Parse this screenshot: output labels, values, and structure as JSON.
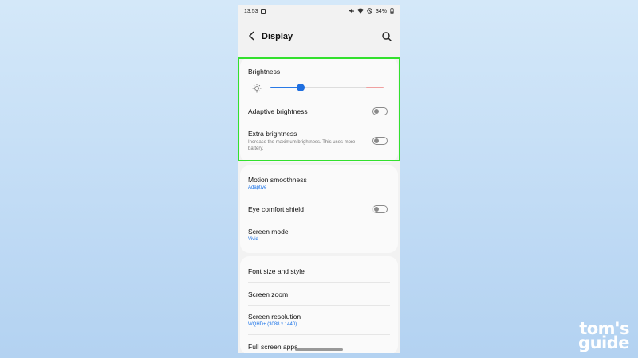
{
  "status_bar": {
    "time": "13:53",
    "battery": "34%",
    "icons": [
      "gallery-icon",
      "mute-icon",
      "wifi-icon",
      "do-not-disturb-icon",
      "battery-icon"
    ]
  },
  "app_bar": {
    "title": "Display",
    "back_icon": "back-arrow-icon",
    "search_icon": "search-icon"
  },
  "brightness_card": {
    "brightness_label": "Brightness",
    "brightness_level": 0.27,
    "adaptive_brightness": {
      "label": "Adaptive brightness",
      "enabled": false
    },
    "extra_brightness": {
      "label": "Extra brightness",
      "description": "Increase the maximum brightness. This uses more battery.",
      "enabled": false
    }
  },
  "display_card": {
    "motion_smoothness": {
      "label": "Motion smoothness",
      "value": "Adaptive"
    },
    "eye_comfort": {
      "label": "Eye comfort shield",
      "enabled": false
    },
    "screen_mode": {
      "label": "Screen mode",
      "value": "Vivid"
    }
  },
  "more_card": {
    "font_size": {
      "label": "Font size and style"
    },
    "screen_zoom": {
      "label": "Screen zoom"
    },
    "screen_resolution": {
      "label": "Screen resolution",
      "value": "WQHD+ (3088 x 1440)"
    },
    "full_screen_apps": {
      "label": "Full screen apps"
    }
  },
  "watermark": {
    "line1": "tom's",
    "line2": "guide"
  },
  "colors": {
    "accent": "#1f6fe0",
    "highlight": "#33e02e",
    "background": "#c2dcf5"
  }
}
